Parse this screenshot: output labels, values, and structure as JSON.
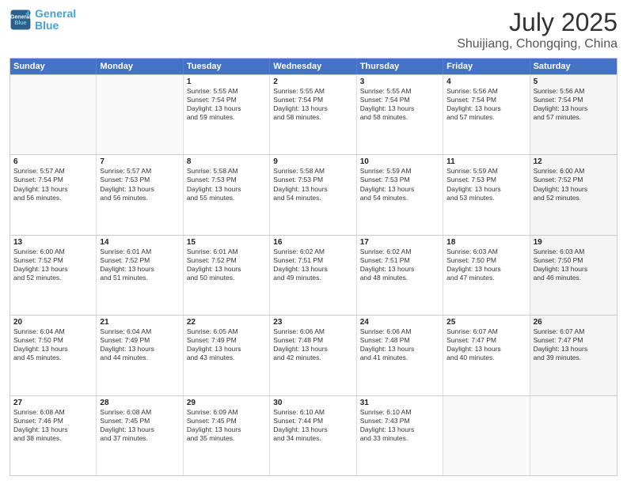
{
  "header": {
    "logo_line1": "General",
    "logo_line2": "Blue",
    "main_title": "July 2025",
    "subtitle": "Shuijiang, Chongqing, China"
  },
  "days_of_week": [
    "Sunday",
    "Monday",
    "Tuesday",
    "Wednesday",
    "Thursday",
    "Friday",
    "Saturday"
  ],
  "weeks": [
    [
      {
        "day": "",
        "lines": [],
        "empty": true
      },
      {
        "day": "",
        "lines": [],
        "empty": true
      },
      {
        "day": "1",
        "lines": [
          "Sunrise: 5:55 AM",
          "Sunset: 7:54 PM",
          "Daylight: 13 hours",
          "and 59 minutes."
        ],
        "shaded": false
      },
      {
        "day": "2",
        "lines": [
          "Sunrise: 5:55 AM",
          "Sunset: 7:54 PM",
          "Daylight: 13 hours",
          "and 58 minutes."
        ],
        "shaded": false
      },
      {
        "day": "3",
        "lines": [
          "Sunrise: 5:55 AM",
          "Sunset: 7:54 PM",
          "Daylight: 13 hours",
          "and 58 minutes."
        ],
        "shaded": false
      },
      {
        "day": "4",
        "lines": [
          "Sunrise: 5:56 AM",
          "Sunset: 7:54 PM",
          "Daylight: 13 hours",
          "and 57 minutes."
        ],
        "shaded": false
      },
      {
        "day": "5",
        "lines": [
          "Sunrise: 5:56 AM",
          "Sunset: 7:54 PM",
          "Daylight: 13 hours",
          "and 57 minutes."
        ],
        "shaded": true
      }
    ],
    [
      {
        "day": "6",
        "lines": [
          "Sunrise: 5:57 AM",
          "Sunset: 7:54 PM",
          "Daylight: 13 hours",
          "and 56 minutes."
        ],
        "shaded": false
      },
      {
        "day": "7",
        "lines": [
          "Sunrise: 5:57 AM",
          "Sunset: 7:53 PM",
          "Daylight: 13 hours",
          "and 56 minutes."
        ],
        "shaded": false
      },
      {
        "day": "8",
        "lines": [
          "Sunrise: 5:58 AM",
          "Sunset: 7:53 PM",
          "Daylight: 13 hours",
          "and 55 minutes."
        ],
        "shaded": false
      },
      {
        "day": "9",
        "lines": [
          "Sunrise: 5:58 AM",
          "Sunset: 7:53 PM",
          "Daylight: 13 hours",
          "and 54 minutes."
        ],
        "shaded": false
      },
      {
        "day": "10",
        "lines": [
          "Sunrise: 5:59 AM",
          "Sunset: 7:53 PM",
          "Daylight: 13 hours",
          "and 54 minutes."
        ],
        "shaded": false
      },
      {
        "day": "11",
        "lines": [
          "Sunrise: 5:59 AM",
          "Sunset: 7:53 PM",
          "Daylight: 13 hours",
          "and 53 minutes."
        ],
        "shaded": false
      },
      {
        "day": "12",
        "lines": [
          "Sunrise: 6:00 AM",
          "Sunset: 7:52 PM",
          "Daylight: 13 hours",
          "and 52 minutes."
        ],
        "shaded": true
      }
    ],
    [
      {
        "day": "13",
        "lines": [
          "Sunrise: 6:00 AM",
          "Sunset: 7:52 PM",
          "Daylight: 13 hours",
          "and 52 minutes."
        ],
        "shaded": false
      },
      {
        "day": "14",
        "lines": [
          "Sunrise: 6:01 AM",
          "Sunset: 7:52 PM",
          "Daylight: 13 hours",
          "and 51 minutes."
        ],
        "shaded": false
      },
      {
        "day": "15",
        "lines": [
          "Sunrise: 6:01 AM",
          "Sunset: 7:52 PM",
          "Daylight: 13 hours",
          "and 50 minutes."
        ],
        "shaded": false
      },
      {
        "day": "16",
        "lines": [
          "Sunrise: 6:02 AM",
          "Sunset: 7:51 PM",
          "Daylight: 13 hours",
          "and 49 minutes."
        ],
        "shaded": false
      },
      {
        "day": "17",
        "lines": [
          "Sunrise: 6:02 AM",
          "Sunset: 7:51 PM",
          "Daylight: 13 hours",
          "and 48 minutes."
        ],
        "shaded": false
      },
      {
        "day": "18",
        "lines": [
          "Sunrise: 6:03 AM",
          "Sunset: 7:50 PM",
          "Daylight: 13 hours",
          "and 47 minutes."
        ],
        "shaded": false
      },
      {
        "day": "19",
        "lines": [
          "Sunrise: 6:03 AM",
          "Sunset: 7:50 PM",
          "Daylight: 13 hours",
          "and 46 minutes."
        ],
        "shaded": true
      }
    ],
    [
      {
        "day": "20",
        "lines": [
          "Sunrise: 6:04 AM",
          "Sunset: 7:50 PM",
          "Daylight: 13 hours",
          "and 45 minutes."
        ],
        "shaded": false
      },
      {
        "day": "21",
        "lines": [
          "Sunrise: 6:04 AM",
          "Sunset: 7:49 PM",
          "Daylight: 13 hours",
          "and 44 minutes."
        ],
        "shaded": false
      },
      {
        "day": "22",
        "lines": [
          "Sunrise: 6:05 AM",
          "Sunset: 7:49 PM",
          "Daylight: 13 hours",
          "and 43 minutes."
        ],
        "shaded": false
      },
      {
        "day": "23",
        "lines": [
          "Sunrise: 6:06 AM",
          "Sunset: 7:48 PM",
          "Daylight: 13 hours",
          "and 42 minutes."
        ],
        "shaded": false
      },
      {
        "day": "24",
        "lines": [
          "Sunrise: 6:06 AM",
          "Sunset: 7:48 PM",
          "Daylight: 13 hours",
          "and 41 minutes."
        ],
        "shaded": false
      },
      {
        "day": "25",
        "lines": [
          "Sunrise: 6:07 AM",
          "Sunset: 7:47 PM",
          "Daylight: 13 hours",
          "and 40 minutes."
        ],
        "shaded": false
      },
      {
        "day": "26",
        "lines": [
          "Sunrise: 6:07 AM",
          "Sunset: 7:47 PM",
          "Daylight: 13 hours",
          "and 39 minutes."
        ],
        "shaded": true
      }
    ],
    [
      {
        "day": "27",
        "lines": [
          "Sunrise: 6:08 AM",
          "Sunset: 7:46 PM",
          "Daylight: 13 hours",
          "and 38 minutes."
        ],
        "shaded": false
      },
      {
        "day": "28",
        "lines": [
          "Sunrise: 6:08 AM",
          "Sunset: 7:45 PM",
          "Daylight: 13 hours",
          "and 37 minutes."
        ],
        "shaded": false
      },
      {
        "day": "29",
        "lines": [
          "Sunrise: 6:09 AM",
          "Sunset: 7:45 PM",
          "Daylight: 13 hours",
          "and 35 minutes."
        ],
        "shaded": false
      },
      {
        "day": "30",
        "lines": [
          "Sunrise: 6:10 AM",
          "Sunset: 7:44 PM",
          "Daylight: 13 hours",
          "and 34 minutes."
        ],
        "shaded": false
      },
      {
        "day": "31",
        "lines": [
          "Sunrise: 6:10 AM",
          "Sunset: 7:43 PM",
          "Daylight: 13 hours",
          "and 33 minutes."
        ],
        "shaded": false
      },
      {
        "day": "",
        "lines": [],
        "empty": true
      },
      {
        "day": "",
        "lines": [],
        "empty": true,
        "shaded": true
      }
    ]
  ]
}
